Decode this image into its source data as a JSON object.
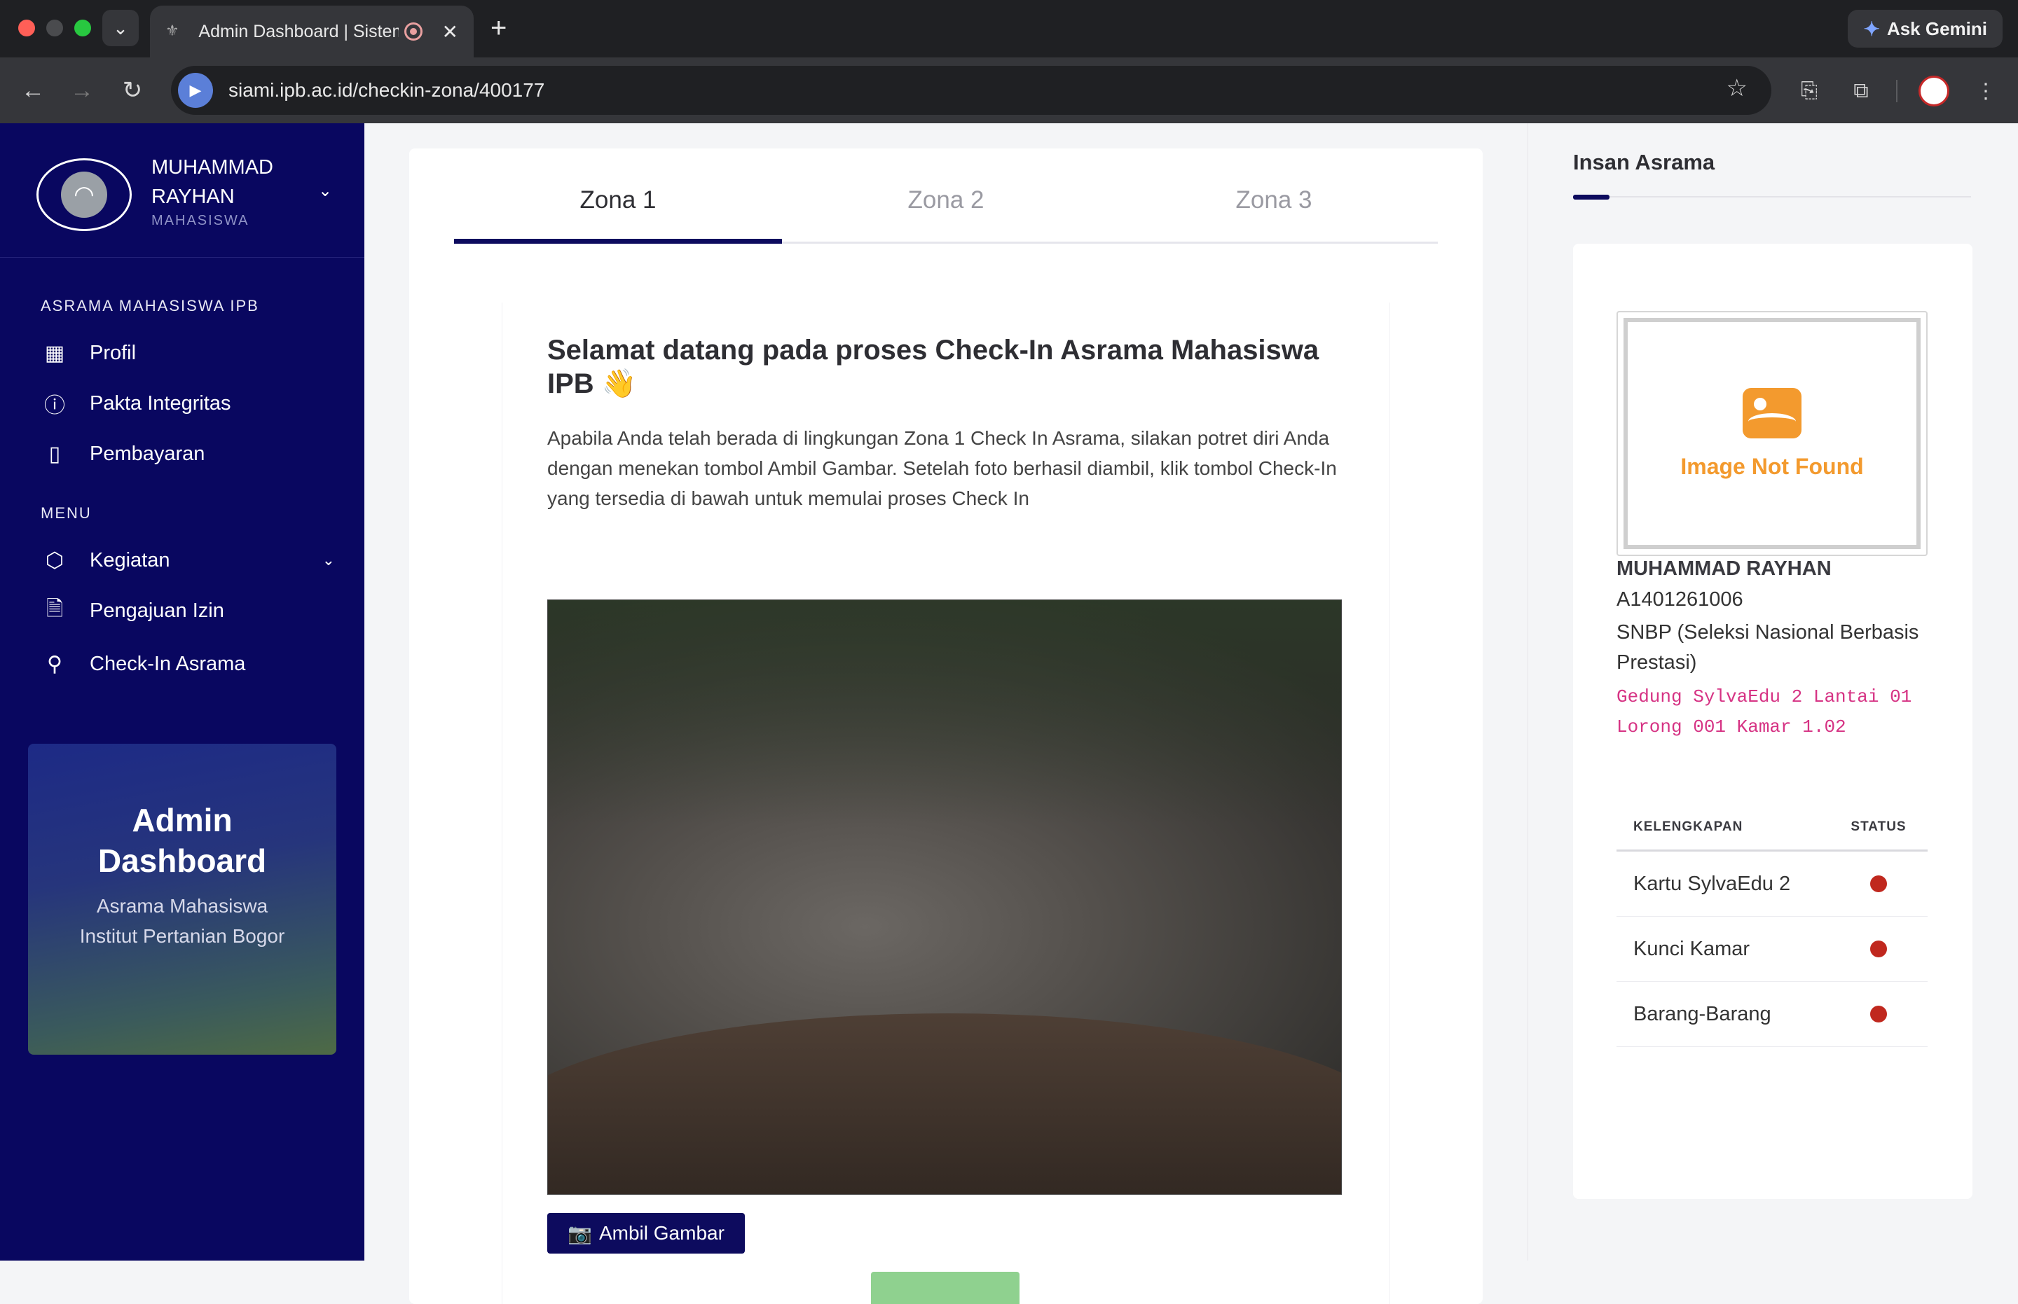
{
  "browser": {
    "tab_title": "Admin Dashboard | Sistem",
    "url": "siami.ipb.ac.id/checkin-zona/400177",
    "gemini_label": "Ask Gemini"
  },
  "sidebar": {
    "user_name": "MUHAMMAD RAYHAN",
    "user_role": "MAHASISWA",
    "section1_title": "ASRAMA MAHASISWA IPB",
    "section1_items": [
      {
        "label": "Profil",
        "icon": "layout-icon"
      },
      {
        "label": "Pakta Integritas",
        "icon": "info-icon"
      },
      {
        "label": "Pembayaran",
        "icon": "book-icon"
      }
    ],
    "section2_title": "MENU",
    "section2_items": [
      {
        "label": "Kegiatan",
        "icon": "box-icon"
      },
      {
        "label": "Pengajuan Izin",
        "icon": "file-icon"
      },
      {
        "label": "Check-In Asrama",
        "icon": "map-pin-icon"
      }
    ],
    "card_title": "Admin Dashboard",
    "card_subtitle": "Asrama Mahasiswa Institut Pertanian Bogor"
  },
  "main": {
    "tabs": [
      "Zona 1",
      "Zona 2",
      "Zona 3"
    ],
    "active_tab": "Zona 1",
    "welcome": "Selamat datang pada proses Check-In Asrama Mahasiswa IPB 👋",
    "description": "Apabila Anda telah berada di lingkungan Zona 1 Check In Asrama, silakan potret diri Anda dengan menekan tombol Ambil Gambar. Setelah foto berhasil diambil, klik tombol Check-In yang tersedia di bawah untuk memulai proses Check In",
    "capture_button": "Ambil Gambar"
  },
  "right_panel": {
    "title": "Insan Asrama",
    "image_placeholder": "Image Not Found",
    "name": "MUHAMMAD RAYHAN",
    "nim": "A1401261006",
    "jalur": "SNBP (Seleksi Nasional Berbasis Prestasi)",
    "room": "Gedung SylvaEdu 2 Lantai 01 Lorong 001 Kamar 1.02",
    "table_headers": [
      "KELENGKAPAN",
      "STATUS"
    ],
    "items": [
      {
        "label": "Kartu SylvaEdu 2",
        "status_color": "#c0281e"
      },
      {
        "label": "Kunci Kamar",
        "status_color": "#c0281e"
      },
      {
        "label": "Barang-Barang",
        "status_color": "#c0281e"
      }
    ]
  },
  "colors": {
    "primary": "#0d0b5e",
    "warning": "#f39a2e",
    "danger": "#c0281e",
    "room_text": "#d63384"
  }
}
